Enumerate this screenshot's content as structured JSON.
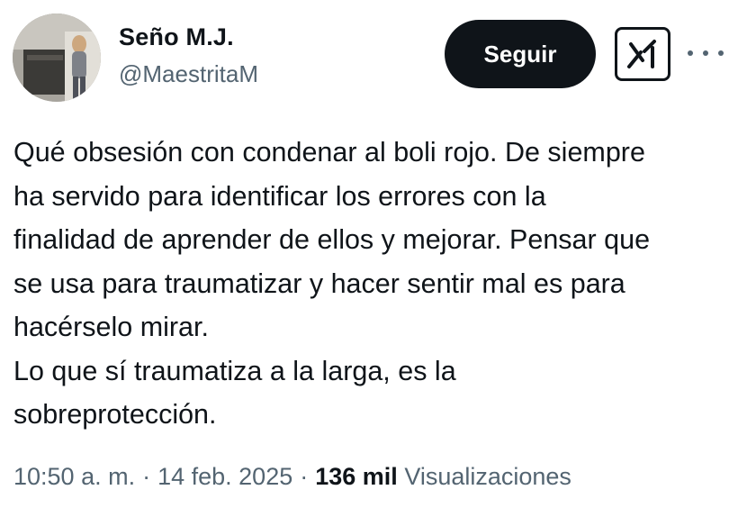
{
  "author": {
    "display_name": "Seño M.J.",
    "handle": "@MaestritaM"
  },
  "actions": {
    "follow_label": "Seguir",
    "grok_icon": "grok-icon",
    "more_icon": "more-horizontal-icon"
  },
  "tweet": {
    "lines": [
      "Qué obsesión con condenar al boli rojo. De siempre",
      "ha servido para identificar los errores con la",
      "finalidad de aprender de ellos y mejorar. Pensar que",
      "se usa para traumatizar y hacer sentir mal es para",
      "hacérselo mirar.",
      "Lo que sí traumatiza a la larga, es la",
      "sobreprotección."
    ]
  },
  "meta": {
    "time": "10:50 a. m.",
    "separator": "·",
    "date": "14 feb. 2025",
    "views_count": "136 mil",
    "views_label": "Visualizaciones"
  },
  "colors": {
    "text": "#0f1419",
    "secondary": "#536471",
    "button_bg": "#0f1419",
    "button_text": "#ffffff"
  }
}
